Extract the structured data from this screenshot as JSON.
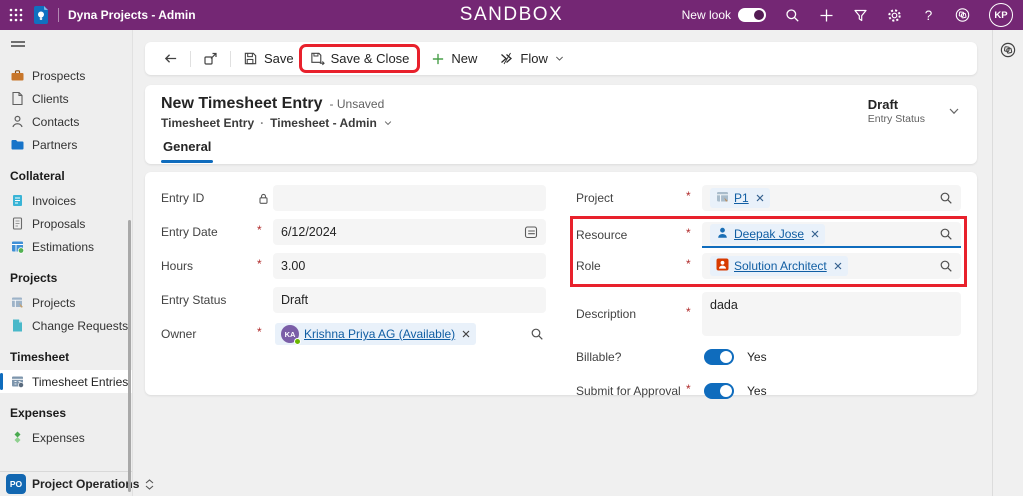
{
  "topbar": {
    "app_title": "Dyna Projects - Admin",
    "environment_banner": "SANDBOX",
    "new_look_label": "New look",
    "new_look_state": "on",
    "help_glyph": "?",
    "avatar_initials": "KP",
    "icons": [
      "waffle-icon",
      "app-logo-icon",
      "search-icon",
      "add-icon",
      "filter-icon",
      "settings-icon",
      "help-icon",
      "copilot-icon"
    ]
  },
  "command_bar": {
    "save": "Save",
    "save_and_close": "Save & Close",
    "new": "New",
    "flow": "Flow"
  },
  "record_header": {
    "title": "New Timesheet Entry",
    "save_state": "- Unsaved",
    "entity_name": "Timesheet Entry",
    "separator": "·",
    "form_selector": "Timesheet - Admin",
    "tab_general": "General",
    "status_value": "Draft",
    "status_caption": "Entry Status"
  },
  "sidebar": {
    "sections": [
      {
        "header": "",
        "items": [
          {
            "label": "Prospects"
          },
          {
            "label": "Clients"
          },
          {
            "label": "Contacts"
          },
          {
            "label": "Partners"
          }
        ]
      },
      {
        "header": "Collateral",
        "items": [
          {
            "label": "Invoices"
          },
          {
            "label": "Proposals"
          },
          {
            "label": "Estimations"
          }
        ]
      },
      {
        "header": "Projects",
        "items": [
          {
            "label": "Projects"
          },
          {
            "label": "Change Requests"
          }
        ]
      },
      {
        "header": "Timesheet",
        "items": [
          {
            "label": "Timesheet Entries",
            "selected": true
          }
        ]
      },
      {
        "header": "Expenses",
        "items": [
          {
            "label": "Expenses"
          }
        ]
      }
    ],
    "area_switcher": {
      "logo": "PO",
      "label": "Project Operations"
    }
  },
  "form": {
    "entry_id": {
      "label": "Entry ID",
      "value": "",
      "locked": true
    },
    "entry_date": {
      "label": "Entry Date",
      "value": "6/12/2024",
      "required": true
    },
    "hours": {
      "label": "Hours",
      "value": "3.00",
      "required": true
    },
    "entry_status": {
      "label": "Entry Status",
      "value": "Draft"
    },
    "owner": {
      "label": "Owner",
      "value": "Krishna Priya AG (Available)",
      "avatar_initials": "KA",
      "required": true
    },
    "project": {
      "label": "Project",
      "value": "P1",
      "required": true
    },
    "resource": {
      "label": "Resource",
      "value": "Deepak Jose",
      "required": true,
      "focused": true
    },
    "role": {
      "label": "Role",
      "value": "Solution Architect",
      "required": true
    },
    "description": {
      "label": "Description",
      "value": "dada",
      "required": true
    },
    "billable": {
      "label": "Billable?",
      "value": "Yes",
      "state": "on"
    },
    "submit_for_approval": {
      "label": "Submit for Approval",
      "value": "Yes",
      "state": "on",
      "required": true
    }
  },
  "annotations": {
    "highlight_color": "#e8212c",
    "highlighted": [
      "save-and-close-button",
      "resource-and-role-fields"
    ]
  },
  "colors": {
    "header_purple": "#742774",
    "accent_blue": "#0f6cbd",
    "link_blue": "#115ea3",
    "toggle_on": "#0f6cbd"
  }
}
